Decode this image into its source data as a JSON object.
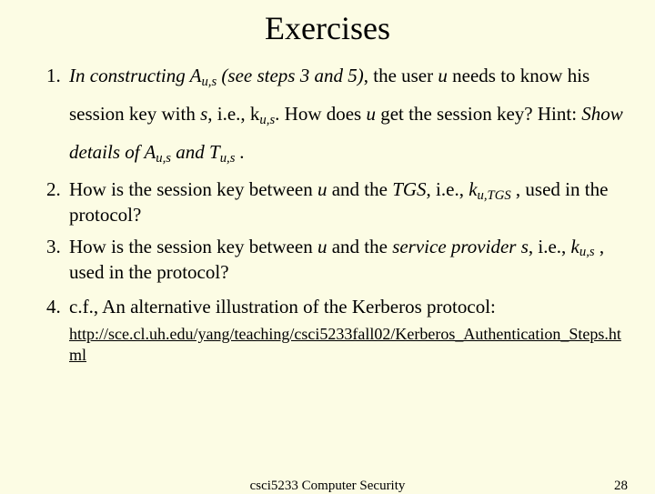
{
  "title": "Exercises",
  "q1": {
    "p1a": "In constructing A",
    "p1sub": "u,s",
    "p1b": " (see steps 3 and 5)",
    "p1c": ", the user ",
    "p1d": "u",
    "p1e": " needs to know his session key with ",
    "p1f": "s",
    "p1g": ", i.e., k",
    "p1gsub": "u,s",
    "p1h": ".  How does ",
    "p1i": "u",
    "p1j": " get the session key?    Hint: ",
    "p1k": "Show details of A",
    "p1ksub": "u,s",
    "p1l": " and T",
    "p1lsub": "u,s",
    "p1m": " ."
  },
  "q2": {
    "a": "How is the session key between ",
    "b": "u",
    "c": " and the ",
    "d": "TGS",
    "e": ", i.e., ",
    "f": "k",
    "fsub": "u,TGS",
    "g": " , used in the protocol?"
  },
  "q3": {
    "a": "How is the session key between ",
    "b": "u",
    "c": " and the ",
    "d": "service provider s",
    "e": ", i.e., ",
    "f": "k",
    "fsub": "u,s",
    "g": " , used in the protocol?"
  },
  "q4": {
    "a": "c.f., An alternative illustration of the Kerberos protocol:",
    "link": "http://sce.cl.uh.edu/yang/teaching/csci5233fall02/Kerberos_Authentication_Steps.html"
  },
  "footer": {
    "center": "csci5233 Computer Security",
    "page": "28"
  }
}
